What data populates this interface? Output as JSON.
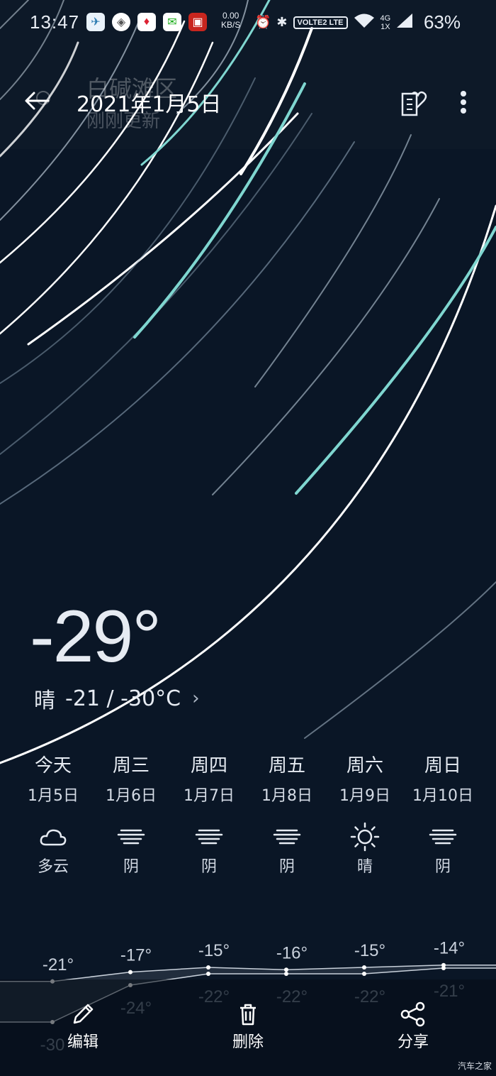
{
  "status_bar": {
    "time": "13:47",
    "net_speed_value": "0.00",
    "net_speed_unit": "KB/S",
    "volte": "VOLTE2 LTE",
    "network_type_top": "4G",
    "network_type_bottom": "1X",
    "battery": "63%",
    "app_icons": [
      "bird-app-icon",
      "shield-app-icon",
      "red-app-icon",
      "wechat-icon",
      "red-box-app-icon"
    ]
  },
  "header": {
    "location_ghost": "白碱滩区",
    "date_title": "2021年1月5日",
    "update_ghost": "刚刚更新"
  },
  "current": {
    "temperature": "-29°",
    "condition": "晴",
    "range": "-21 / -30°C",
    "chevron": "›"
  },
  "forecast": [
    {
      "day": "今天",
      "date": "1月5日",
      "icon": "cloud-icon",
      "cond": "多云"
    },
    {
      "day": "周三",
      "date": "1月6日",
      "icon": "overcast-icon",
      "cond": "阴"
    },
    {
      "day": "周四",
      "date": "1月7日",
      "icon": "overcast-icon",
      "cond": "阴"
    },
    {
      "day": "周五",
      "date": "1月8日",
      "icon": "overcast-icon",
      "cond": "阴"
    },
    {
      "day": "周六",
      "date": "1月9日",
      "icon": "sun-icon",
      "cond": "晴"
    },
    {
      "day": "周日",
      "date": "1月10日",
      "icon": "overcast-icon",
      "cond": "阴"
    }
  ],
  "chart_data": {
    "type": "line",
    "categories": [
      "今天",
      "周三",
      "周四",
      "周五",
      "周六",
      "周日"
    ],
    "series": [
      {
        "values": [
          -21,
          -17,
          -15,
          -16,
          -15,
          -14
        ]
      },
      {
        "values": [
          -30,
          -24,
          -22,
          -22,
          -22,
          -21
        ]
      }
    ],
    "high_labels": [
      "-21°",
      "-17°",
      "-15°",
      "-16°",
      "-15°",
      "-14°"
    ],
    "low_labels": [
      "-30",
      "-24°",
      "-22°",
      "-22°",
      "-22°",
      "-21°"
    ],
    "line_color": "#c8d0da",
    "band_color": "#2a3645"
  },
  "actions": {
    "edit": "编辑",
    "delete": "删除",
    "share": "分享"
  },
  "watermark": "汽车之家",
  "colors": {
    "background": "#0a1626",
    "streak_teal": "#7fd6d0",
    "streak_white": "#ffffff"
  }
}
